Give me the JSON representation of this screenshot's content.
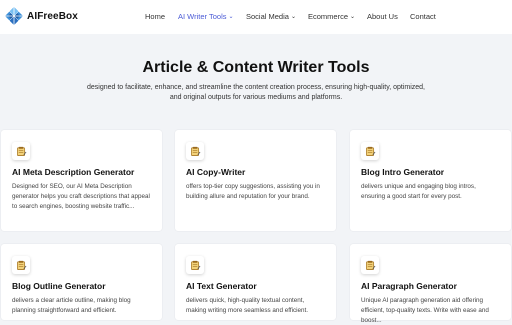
{
  "brand": {
    "name": "AIFreeBox"
  },
  "nav": {
    "home": "Home",
    "writer_tools": "AI Writer Tools",
    "social_media": "Social Media",
    "ecommerce": "Ecommerce",
    "about": "About Us",
    "contact": "Contact"
  },
  "hero": {
    "title": "Article & Content Writer Tools",
    "subtitle": "designed to facilitate, enhance, and streamline the content creation process, ensuring high-quality, optimized, and original outputs for various mediums and platforms."
  },
  "cards": [
    {
      "title": "AI Meta Description Generator",
      "desc": "Designed for SEO, our AI Meta Description generator helps you craft descriptions that appeal to search engines, boosting website traffic..."
    },
    {
      "title": "AI Copy-Writer",
      "desc": "offers top-tier copy suggestions, assisting you in building allure and reputation for your brand."
    },
    {
      "title": "Blog Intro Generator",
      "desc": "delivers unique and engaging blog intros, ensuring a good start for every post."
    },
    {
      "title": "Blog Outline Generator",
      "desc": "delivers a clear article outline, making blog planning straightforward and efficient."
    },
    {
      "title": "AI Text Generator",
      "desc": "delivers quick, high-quality textual content, making writing more seamless and efficient."
    },
    {
      "title": "AI Paragraph Generator",
      "desc": "Unique AI paragraph generation aid offering efficient, top-quality texts. Write with ease and boost..."
    }
  ],
  "colors": {
    "accent": "#4b5bd6",
    "background": "#f2f4f7",
    "card": "#ffffff"
  },
  "icons": {
    "card": "notepad-icon",
    "logo": "aifreebox-logo-icon"
  }
}
